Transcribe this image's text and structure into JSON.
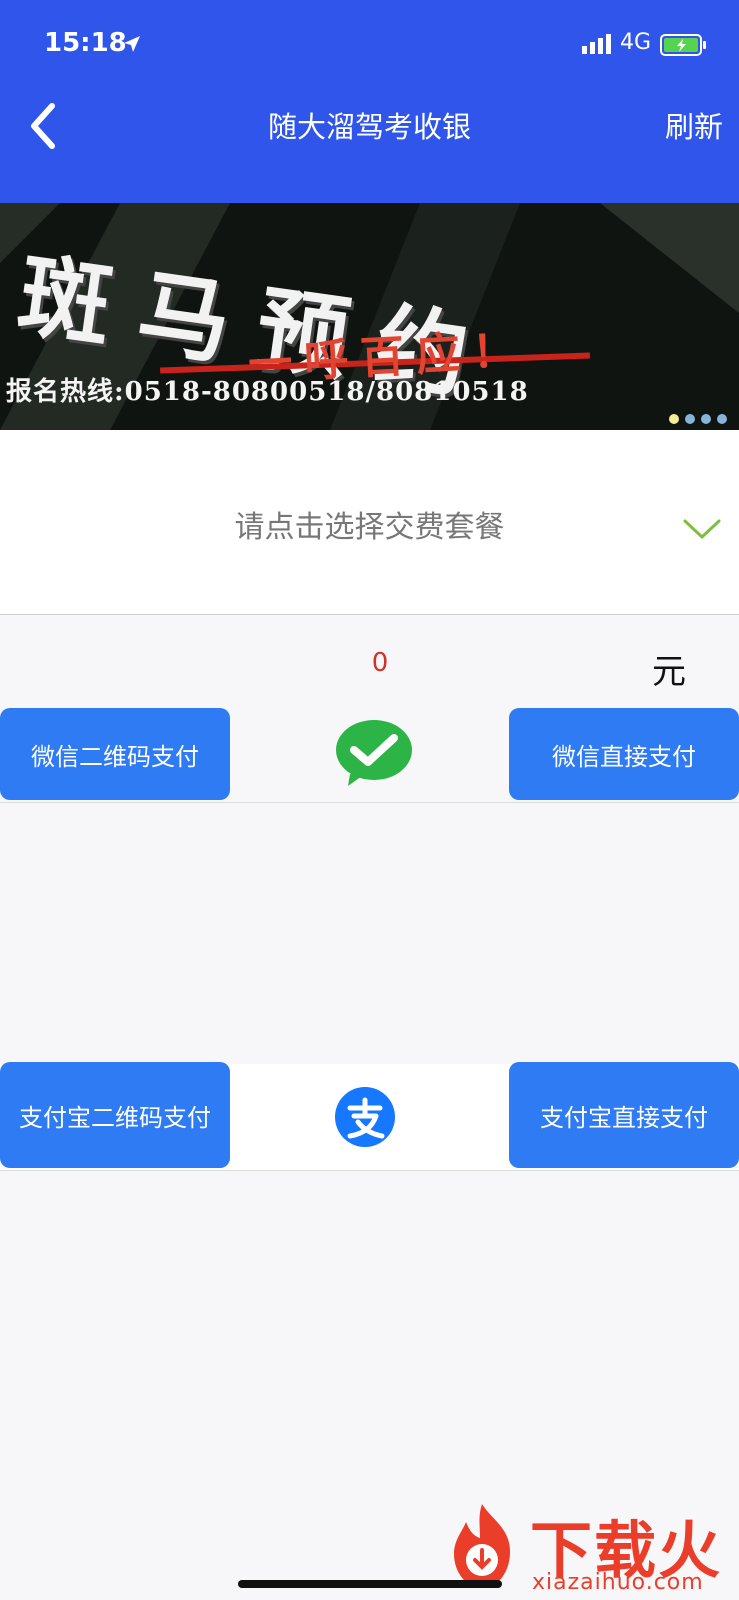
{
  "status_bar": {
    "time": "15:18",
    "network": "4G"
  },
  "header": {
    "title": "随大溜驾考收银",
    "refresh_label": "刷新"
  },
  "banner": {
    "title": "斑马预约",
    "slogan": "一呼百应！",
    "hotline": "报名热线:0518-80800518/80810518",
    "slide_count": 4,
    "active_slide": 1
  },
  "selector": {
    "placeholder": "请点击选择交费套餐"
  },
  "amount": {
    "value": "0",
    "unit": "元"
  },
  "wechat": {
    "qr_label": "微信二维码支付",
    "direct_label": "微信直接支付"
  },
  "alipay": {
    "qr_label": "支付宝二维码支付",
    "direct_label": "支付宝直接支付"
  },
  "watermark": {
    "brand": "下载火",
    "url": "xiazaihuo.com"
  },
  "colors": {
    "primary": "#2f55ea",
    "button": "#2f7bf3",
    "amount": "#d1332a",
    "wechat": "#2cb546",
    "alipay": "#1677ff",
    "check": "#7fbf3f"
  }
}
